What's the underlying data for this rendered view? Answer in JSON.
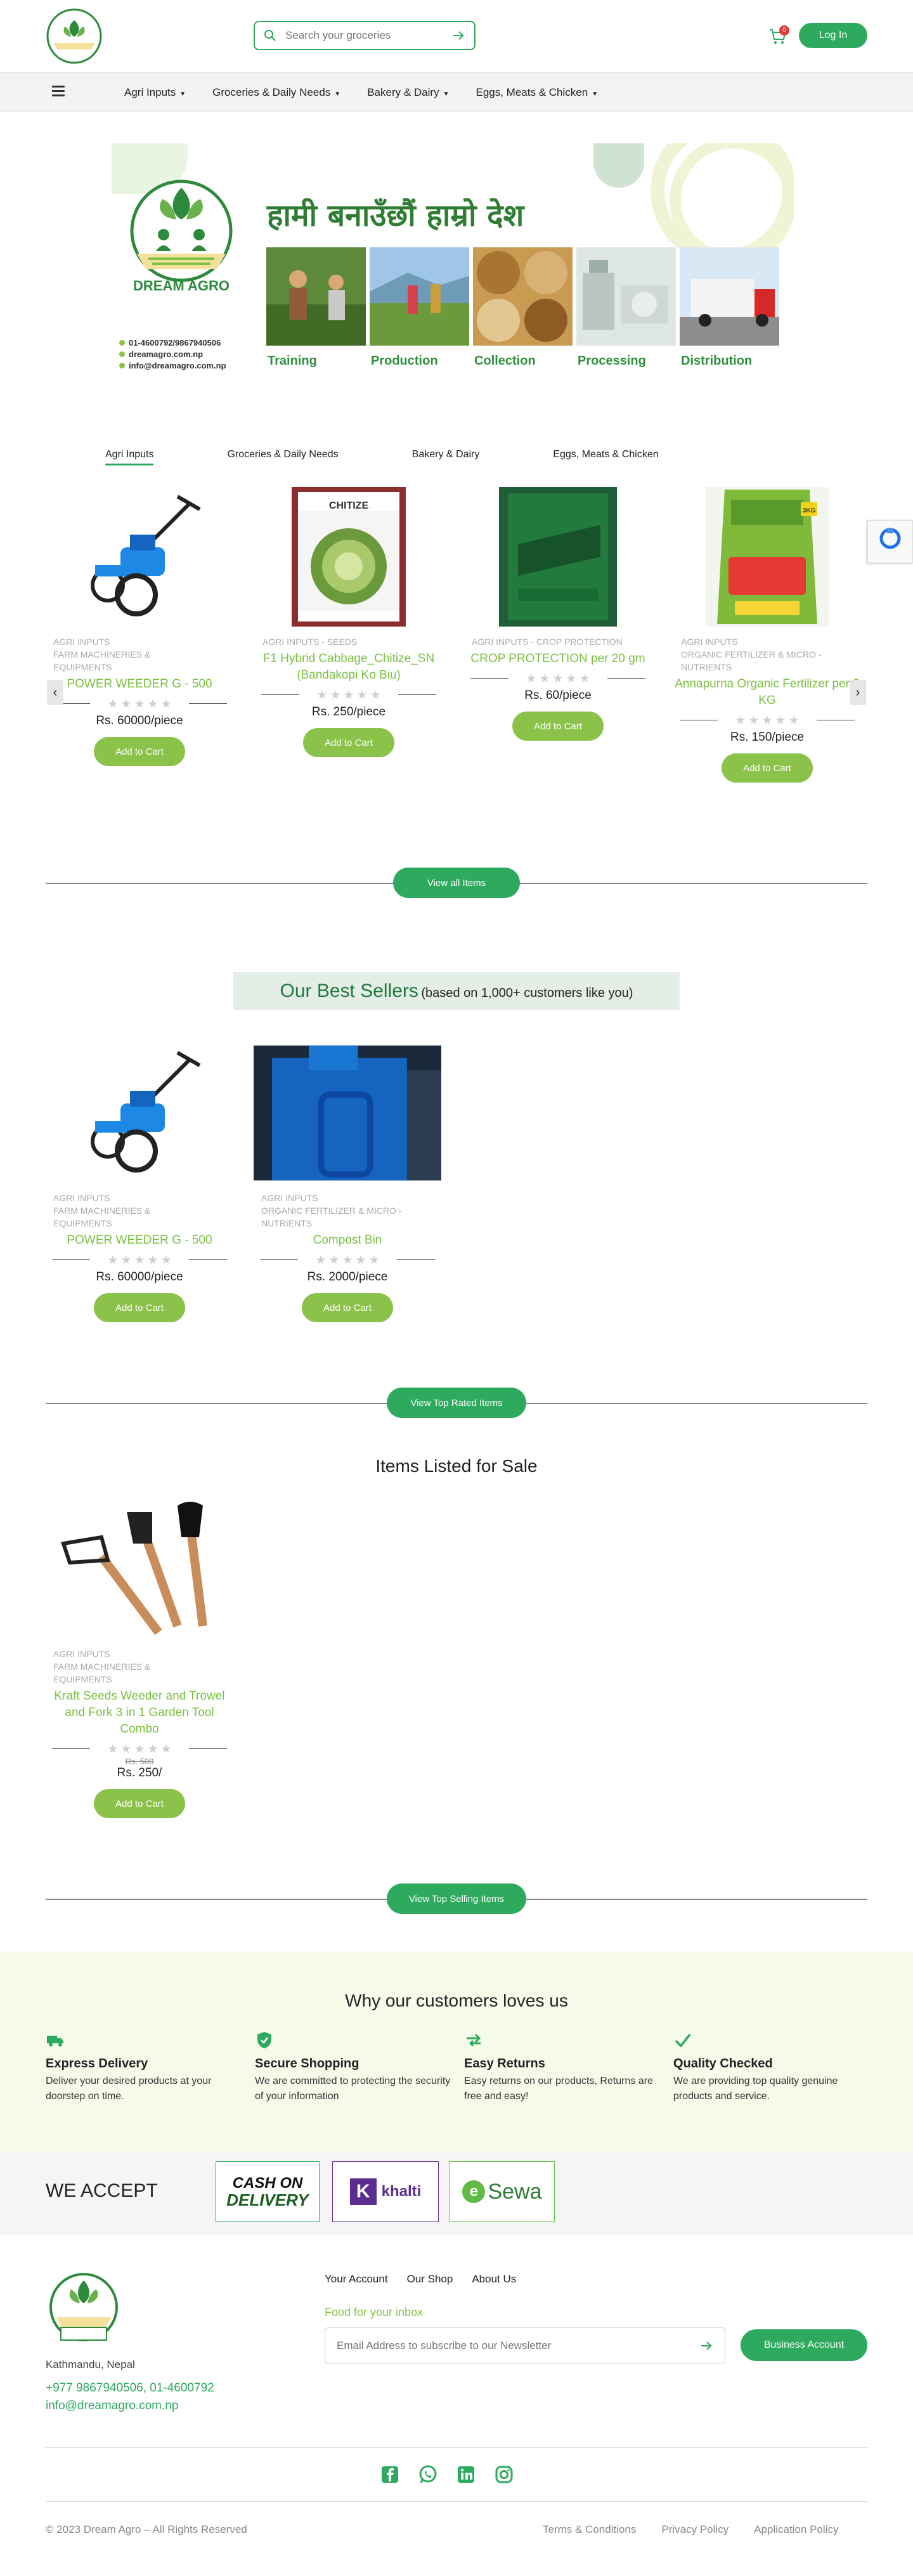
{
  "header": {
    "search_placeholder": "Search your groceries",
    "cart_count": "0",
    "login_label": "Log In",
    "logo_text": "DREAM AGRO"
  },
  "nav": {
    "items": [
      "Agri Inputs",
      "Groceries & Daily Needs",
      "Bakery & Dairy",
      "Eggs, Meats & Chicken"
    ]
  },
  "banner": {
    "title": "हामी बनाउँछौं हाम्रो देश",
    "logo_name": "DREAM AGRO",
    "labels": [
      "Training",
      "Production",
      "Collection",
      "Processing",
      "Distribution"
    ],
    "phone": "01-4600792/9867940506",
    "web": "dreamagro.com.np",
    "email": "info@dreamagro.com.np"
  },
  "tabs": [
    "Agri Inputs",
    "Groceries & Daily Needs",
    "Bakery & Dairy",
    "Eggs, Meats & Chicken"
  ],
  "featured": [
    {
      "cat1": "AGRI INPUTS",
      "cat2": "FARM MACHINERIES &",
      "cat3": "EQUIPMENTS",
      "name": "POWER WEEDER G - 500",
      "price": "Rs. 60000/piece",
      "cta": "Add to Cart"
    },
    {
      "cat1": "AGRI INPUTS - SEEDS",
      "cat2": "",
      "cat3": "",
      "name": "F1 Hybrid Cabbage_Chitize_SN (Bandakopi Ko Biu)",
      "price": "Rs. 250/piece",
      "cta": "Add to Cart",
      "pack_label": "CHITIZE"
    },
    {
      "cat1": "AGRI INPUTS - CROP PROTECTION",
      "cat2": "",
      "cat3": "",
      "name": "CROP PROTECTION per 20 gm",
      "price": "Rs. 60/piece",
      "cta": "Add to Cart"
    },
    {
      "cat1": "AGRI INPUTS",
      "cat2": "ORGANIC FERTILIZER & MICRO -",
      "cat3": "NUTRIENTS",
      "name": "Annapurna Organic Fertilizer per 3 KG",
      "price": "Rs. 150/piece",
      "cta": "Add to Cart",
      "pack_label": "3KG"
    }
  ],
  "view_all": "View all Items",
  "bestsellers": {
    "title": "Our Best Sellers",
    "subtitle": "(based on 1,000+ customers like you)",
    "items": [
      {
        "cat1": "AGRI INPUTS",
        "cat2": "FARM MACHINERIES &",
        "cat3": "EQUIPMENTS",
        "name": "POWER WEEDER G - 500",
        "price": "Rs. 60000/piece",
        "cta": "Add to Cart"
      },
      {
        "cat1": "AGRI INPUTS",
        "cat2": "ORGANIC FERTILIZER & MICRO -",
        "cat3": "NUTRIENTS",
        "name": "Compost Bin",
        "price": "Rs. 2000/piece",
        "cta": "Add to Cart"
      }
    ]
  },
  "view_top_rated": "View Top Rated Items",
  "sale": {
    "title": "Items Listed for Sale",
    "items": [
      {
        "cat1": "AGRI INPUTS",
        "cat2": "FARM MACHINERIES &",
        "cat3": "EQUIPMENTS",
        "name": "Kraft Seeds Weeder and Trowel and Fork 3 in 1 Garden Tool Combo",
        "old_price": "Rs. 500",
        "price": "Rs. 250/",
        "cta": "Add to Cart"
      }
    ]
  },
  "view_top_selling": "View Top Selling Items",
  "why": {
    "title": "Why our customers loves us",
    "features": [
      {
        "title": "Express Delivery",
        "desc": "Deliver your desired products at your doorstep on time."
      },
      {
        "title": "Secure Shopping",
        "desc": "We are committed to protecting the security of your information"
      },
      {
        "title": "Easy Returns",
        "desc": "Easy returns on our products, Returns are free and easy!"
      },
      {
        "title": "Quality Checked",
        "desc": "We are providing top quality genuine products and service."
      }
    ]
  },
  "accept": {
    "label": "WE ACCEPT",
    "cod1": "CASH ON",
    "cod2": "DELIVERY",
    "khalti": "khalti",
    "esewa": "Sewa"
  },
  "footer": {
    "address": "Kathmandu, Nepal",
    "phone": "+977 9867940506, 01-4600792",
    "email": "info@dreamagro.com.np",
    "links": [
      "Your Account",
      "Our Shop",
      "About Us"
    ],
    "food_label": "Food for your inbox",
    "newsletter_placeholder": "Email Address to subscribe to our Newsletter",
    "business_btn": "Business Account",
    "copyright": "© 2023 Dream Agro – All Rights Reserved",
    "legal": [
      "Terms & Conditions",
      "Privacy Policy",
      "Application Policy"
    ]
  },
  "colors": {
    "brand": "#2daa5e",
    "accent": "#8bc34a"
  }
}
